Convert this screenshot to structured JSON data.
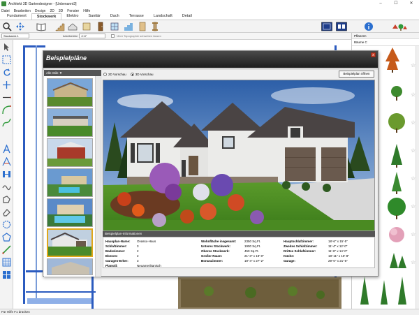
{
  "window": {
    "title": "Architekt 3D Gartendesigner - [Unbenannt3]",
    "buttons": [
      "–",
      "☐",
      "✕"
    ]
  },
  "menu": [
    "Datei",
    "Bearbeiten",
    "Design",
    "2D",
    "3D",
    "Fenster",
    "Hilfe"
  ],
  "ribbon_tabs": [
    {
      "label": "Fundament",
      "active": false
    },
    {
      "label": "Stockwerk",
      "active": true
    },
    {
      "label": "Elektro",
      "active": false
    },
    {
      "label": "Sanitär",
      "active": false
    },
    {
      "label": "Dach",
      "active": false
    },
    {
      "label": "Terrasse",
      "active": false
    },
    {
      "label": "Landschaft",
      "active": false
    },
    {
      "label": "Detail",
      "active": false
    }
  ],
  "optionbar": {
    "floor": "Stockwerk 1",
    "height_label": "Arbeitshöhe",
    "height_value": "4'-0\"",
    "topo_label": "Über Topographie schweben lassen"
  },
  "right_panel": {
    "heading": "Pflanzen",
    "filter": "Bäume C"
  },
  "status": "Für Hilfe F1 drücken",
  "dialog": {
    "title": "Beispielpläne",
    "filter": "Alle Stile ▼",
    "radio_2d": "2D Vorschau",
    "radio_3d": "3D Vorschau",
    "open_button": "Beispielplan öffnen",
    "close": "x",
    "info_heading": "Beispielplan-Informationen",
    "info": {
      "col1": [
        {
          "k": "Hausplan-Name:",
          "v": "Ovasso-Haus"
        },
        {
          "k": "Schlafzimmer:",
          "v": "3"
        },
        {
          "k": "Badezimmer:",
          "v": "2"
        },
        {
          "k": "Ebenen:",
          "v": "2"
        },
        {
          "k": "Garagen-Erker:",
          "v": "3"
        },
        {
          "k": "Planstil:",
          "v": "Neuamerikanisch"
        }
      ],
      "col2": [
        {
          "k": "Wohnfläche insgesamt:",
          "v": "2350 Sq.Ft."
        },
        {
          "k": "Unteres Stockwerk:",
          "v": "1900 Sq.Ft."
        },
        {
          "k": "Oberes Stockwerk:",
          "v": "450 Sq.Ft."
        },
        {
          "k": "Großer Raum:",
          "v": "21'-3\" x 19'-0\""
        },
        {
          "k": "Bonuszimmer:",
          "v": "19'-4\" x 27'-2\""
        }
      ],
      "col3": [
        {
          "k": "Hauptschlafzimmer:",
          "v": "18'-6\" x 15'-5\""
        },
        {
          "k": "Zweites Schlafzimmer:",
          "v": "11'-4\" x 12'-0\""
        },
        {
          "k": "Drittes Schlafzimmer:",
          "v": "11'-6\" x 14'-0\""
        },
        {
          "k": "Küche:",
          "v": "18'-11\" x 16'-8\""
        },
        {
          "k": "Garage:",
          "v": "29'-0\" x 21'-6\""
        }
      ]
    }
  },
  "colors": {
    "accent_selected": "#e0a71a",
    "dialog_header": "#1e1e1e",
    "plan_blue": "#2b5bbf"
  }
}
